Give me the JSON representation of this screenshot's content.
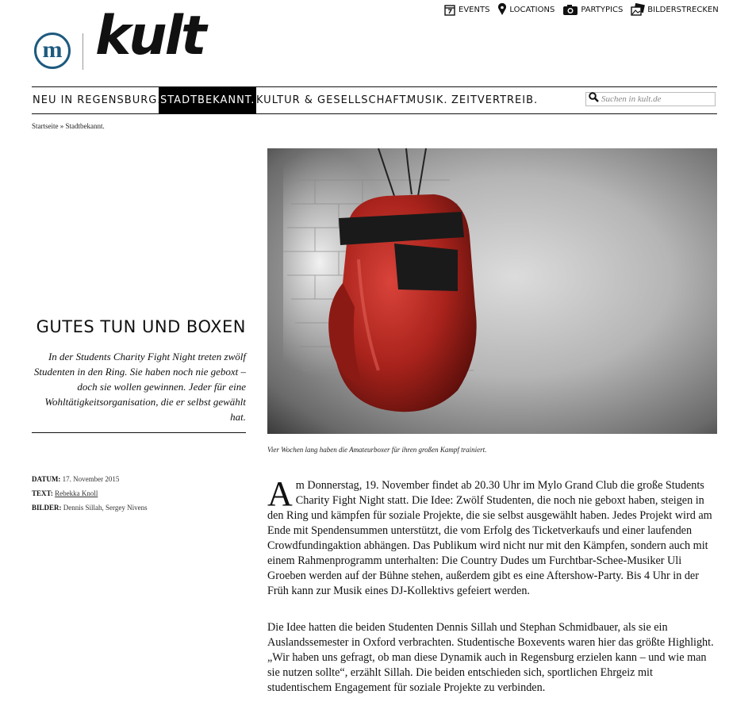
{
  "toplinks": [
    {
      "label": "EVENTS",
      "icon": "calendar-icon"
    },
    {
      "label": "LOCATIONS",
      "icon": "map-pin-icon"
    },
    {
      "label": "PARTYPICS",
      "icon": "camera-icon"
    },
    {
      "label": "BILDERSTRECKEN",
      "icon": "photo-stack-icon"
    }
  ],
  "logo": {
    "m": "m",
    "name": "kult"
  },
  "nav": [
    {
      "label": "NEU IN REGENSBURG."
    },
    {
      "label": "STADTBEKANNT."
    },
    {
      "label": "KULTUR & GESELLSCHAFT."
    },
    {
      "label": "MUSIK."
    },
    {
      "label": "ZEITVERTREIB."
    }
  ],
  "nav_active": "STADTBEKANNT.",
  "search": {
    "placeholder": "Suchen in kult.de"
  },
  "breadcrumb": {
    "home": "Startseite",
    "sep": "»",
    "current": "Stadtbekannt."
  },
  "article": {
    "title": "GUTES TUN UND BOXEN",
    "lede": "In der Students Charity Fight Night treten zwölf Studenten in den Ring. Sie haben noch nie geboxt – doch sie wollen gewinnen. Jeder für eine Wohltätigkeitsorganisation, die er selbst gewählt hat.",
    "caption": "Vier Wochen lang haben die Amateurboxer für ihren großen Kampf trainiert.",
    "meta": {
      "date_label": "DATUM:",
      "date": "17. November 2015",
      "text_label": "TEXT:",
      "author": "Rebekka Knoll",
      "images_label": "BILDER:",
      "images": "Dennis Sillah, Sergey Nivens"
    },
    "dropcap": "A",
    "p1": "m Donnerstag, 19. November findet ab 20.30 Uhr im Mylo Grand Club die große Students Charity Fight Night statt. Die Idee: Zwölf Studenten, die noch nie geboxt haben, steigen in den Ring und kämpfen für soziale Projekte, die sie selbst ausgewählt haben. Jedes Projekt wird am Ende mit Spendensummen unterstützt, die vom Erfolg des Ticketverkaufs und einer laufenden Crowdfundingaktion abhängen. Das Publikum wird nicht nur mit den Kämpfen, sondern auch mit einem Rahmenprogramm unterhalten: Die Country Dudes um Furchtbar-Schee-Musiker Uli Groeben werden auf der Bühne stehen, außerdem gibt es eine Aftershow-Party. Bis 4 Uhr in der Früh kann zur Musik eines DJ-Kollektivs gefeiert werden.",
    "p2": "Die Idee hatten die beiden Studenten Dennis Sillah und Stephan Schmidbauer, als sie ein Auslandssemester in Oxford verbrachten. Studentische Boxevents waren hier das größte Highlight. „Wir haben uns gefragt, ob man diese Dynamik auch in Regensburg erzielen kann – und wie man sie nutzen sollte“, erzählt Sillah. Die beiden entschieden sich, sportlichen Ehrgeiz mit studentischem Engagement für soziale Projekte zu verbinden."
  },
  "colors": {
    "logo_blue": "#1d5a7f",
    "glove_red": "#b3261e",
    "nav_active_bg": "#000000"
  }
}
